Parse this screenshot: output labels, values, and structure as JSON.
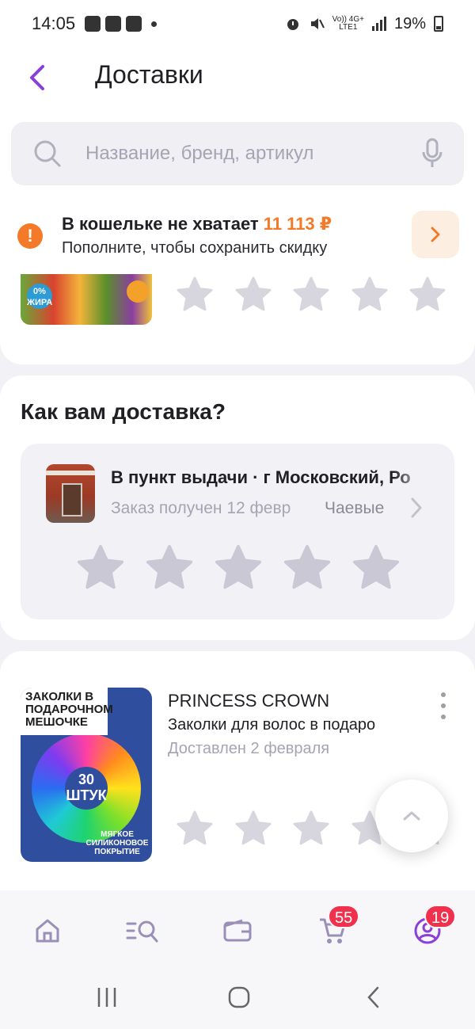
{
  "status_bar": {
    "time": "14:05",
    "battery": "19%",
    "network_top": "Vo)) 4G+",
    "network_bottom": "LTE1"
  },
  "header": {
    "title": "Доставки",
    "back_icon": "chevron-left-icon"
  },
  "search": {
    "placeholder": "Название, бренд, артикул",
    "icons": [
      "search-icon",
      "microphone-icon"
    ]
  },
  "wallet_banner": {
    "title": "В кошельке не хватает",
    "amount": "11 113 ₽",
    "subtitle": "Пополните, чтобы сохранить скидку",
    "accent_color": "#f37a29"
  },
  "previous_item": {
    "image_label": "0% ЖИРА",
    "rating": 0,
    "max_rating": 5
  },
  "delivery_feedback": {
    "title": "Как вам доставка?",
    "pickup_title": "В пункт выдачи · г Московский, Ро",
    "status": "Заказ получен 12 февр",
    "tips_label": "Чаевые",
    "rating": 0,
    "max_rating": 5
  },
  "product": {
    "brand": "PRINCESS CROWN",
    "name": "Заколки для волос в подаро",
    "status": "Доставлен 2 февраля",
    "image_text": {
      "header": "ЗАКОЛКИ В ПОДАРОЧНОМ МЕШОЧКЕ",
      "count": "30 ШТУК",
      "footer": "МЯГКОЕ СИЛИКОНОВОЕ ПОКРЫТИЕ"
    },
    "rating": 0,
    "max_rating": 5
  },
  "bottom_nav": {
    "items": [
      "home-icon",
      "catalog-search-icon",
      "wallet-icon",
      "cart-icon",
      "profile-icon"
    ],
    "cart_badge": "55",
    "profile_badge": "19",
    "accent_color": "#8b3fd9",
    "badge_color": "#f0314d"
  },
  "system_nav": [
    "recents-icon",
    "home-circle-icon",
    "back-icon"
  ]
}
